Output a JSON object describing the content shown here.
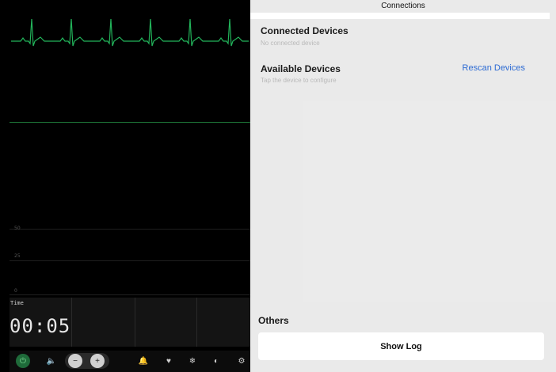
{
  "monitor": {
    "scale_labels": [
      "50",
      "25",
      "0"
    ],
    "time": {
      "title": "Time",
      "value": "00:05"
    },
    "toolbar": {
      "icons": [
        "power-icon",
        "speaker-icon",
        "minus-icon",
        "plus-icon",
        "bell-icon",
        "heart-icon",
        "snowflake-icon",
        "contrast-icon",
        "gear-icon"
      ]
    },
    "colors": {
      "ecg": "#22b35a",
      "background": "#000000"
    }
  },
  "panel": {
    "title": "Connections",
    "connected": {
      "title": "Connected Devices",
      "subtitle": "No connected device"
    },
    "available": {
      "title": "Available Devices",
      "subtitle": "Tap the device to configure",
      "rescan_label": "Rescan Devices"
    },
    "others": {
      "title": "Others",
      "show_log_label": "Show Log"
    },
    "colors": {
      "link": "#2d6bd3"
    }
  }
}
